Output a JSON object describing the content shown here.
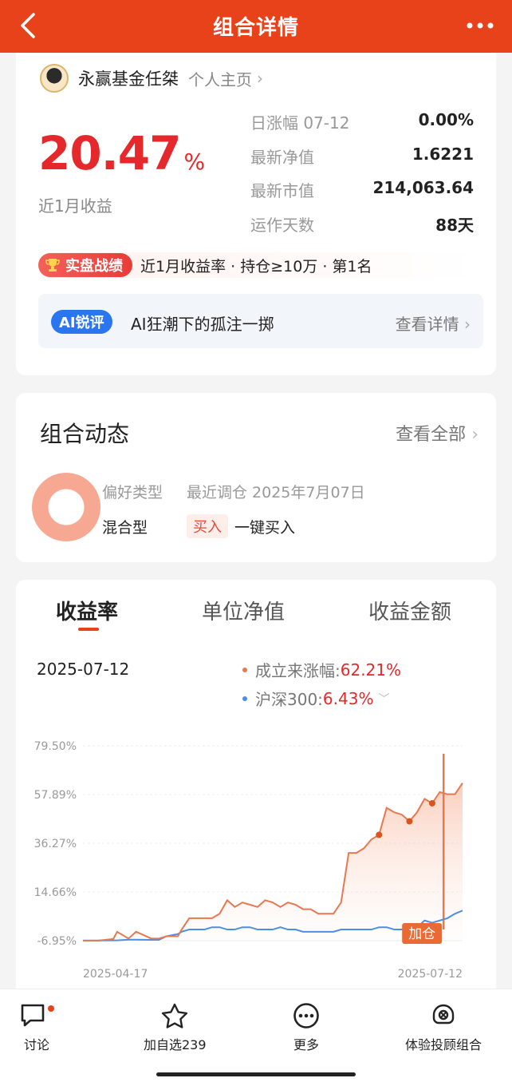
{
  "header": {
    "title": "组合详情",
    "back_icon": "chevron-left-icon",
    "more_icon": "more-dots-icon"
  },
  "manager": {
    "name": "永赢基金任桀",
    "home_link": "个人主页"
  },
  "summary": {
    "return_value": "20.47",
    "return_unit": "%",
    "return_label": "近1月收益",
    "stats": [
      {
        "key": "日涨幅 07-12",
        "value": "0.00%"
      },
      {
        "key": "最新净值",
        "value": "1.6221"
      },
      {
        "key": "最新市值",
        "value": "214,063.64"
      },
      {
        "key": "运作天数",
        "value": "88天"
      }
    ],
    "badge": "实盘战绩",
    "badge_text": "近1月收益率 · 持仓≥10万 · 第1名",
    "ai_tag": "AI锐评",
    "ai_title": "AI狂潮下的孤注一掷",
    "ai_link": "查看详情"
  },
  "dynamics": {
    "title": "组合动态",
    "more": "查看全部",
    "pref_label": "偏好类型",
    "pref_value": "混合型",
    "adjust_label": "最近调仓 2025年7月07日",
    "buy_tag": "买入",
    "buy_text": "一键买入"
  },
  "chart_section": {
    "tabs": [
      "收益率",
      "单位净值",
      "收益金额"
    ],
    "active_tab": 0,
    "date": "2025-07-12",
    "legend": [
      {
        "label": "成立来涨幅:",
        "value": "62.21%",
        "color": "#e8784f"
      },
      {
        "label": "沪深300:",
        "value": "6.43%",
        "color": "#4a90e2"
      }
    ],
    "marker_label": "加仓"
  },
  "chart_data": {
    "type": "line",
    "x_start": "2025-04-17",
    "x_end": "2025-07-12",
    "yticks": [
      "79.50%",
      "57.89%",
      "36.27%",
      "14.66%",
      "-6.95%"
    ],
    "ylim": [
      -6.95,
      79.5
    ],
    "x": [
      0,
      4,
      8,
      9,
      12,
      14,
      18,
      20,
      22,
      25,
      26,
      28,
      32,
      34,
      36,
      38,
      40,
      42,
      44,
      46,
      48,
      50,
      52,
      54,
      56,
      58,
      60,
      62,
      64,
      66,
      68,
      70,
      72,
      74,
      76,
      78,
      80,
      82,
      84,
      86,
      88,
      90,
      92,
      94,
      96,
      98,
      100
    ],
    "series": [
      {
        "name": "成立来涨幅",
        "color": "#e8784f",
        "values": [
          -6.9,
          -6.9,
          -6.2,
          -3,
          -6,
          -3,
          -6,
          -6,
          -5,
          -5,
          -2,
          3,
          3,
          3,
          5,
          11,
          8,
          10,
          9,
          8,
          11,
          10,
          8,
          10,
          9,
          7,
          7,
          5,
          5,
          5,
          10,
          32,
          32,
          34,
          38,
          40,
          52,
          50,
          49,
          46,
          50,
          56,
          54,
          59,
          58,
          58,
          63
        ]
      },
      {
        "name": "沪深300",
        "color": "#4a90e2",
        "values": [
          -6.9,
          -6.9,
          -6.8,
          -6.8,
          -6.5,
          -6.5,
          -6.6,
          -6.6,
          -5,
          -4,
          -3,
          -2,
          -2,
          -1,
          -1,
          -2,
          -2,
          -1,
          -1,
          -2,
          -2,
          -2,
          -1,
          -2,
          -2,
          -3,
          -3,
          -3,
          -3,
          -3,
          -2,
          -2,
          -2,
          -2,
          -2,
          -1,
          -1,
          -2,
          -2,
          -1,
          -1,
          2,
          1,
          2,
          3,
          5,
          6.4
        ]
      }
    ],
    "markers_x": [
      78,
      87,
      93
    ],
    "spike_x": 95
  },
  "bottom_nav": [
    {
      "label": "讨论",
      "icon": "chat-bubble-icon"
    },
    {
      "label": "加自选239",
      "icon": "star-icon"
    },
    {
      "label": "更多",
      "icon": "more-circle-icon"
    },
    {
      "label": "体验投顾组合",
      "icon": "advisor-icon"
    }
  ]
}
